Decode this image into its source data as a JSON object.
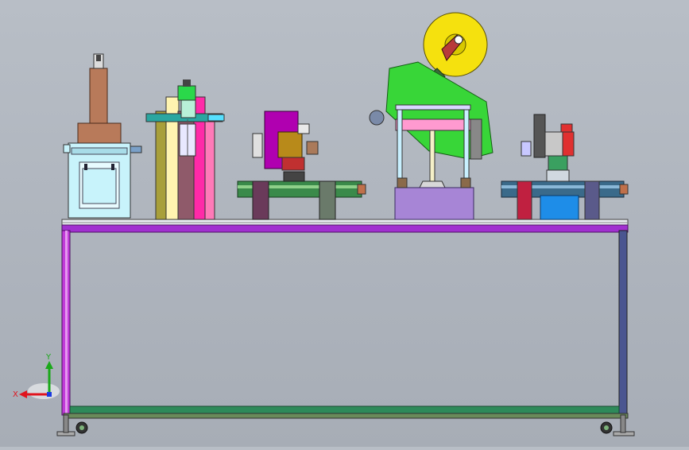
{
  "viewport": {
    "background": [
      "#b8bec6",
      "#a7adb6"
    ]
  },
  "triad": {
    "x_label": "X",
    "y_label": "Y",
    "x_color": "#e0141e",
    "y_color": "#1aa81a",
    "z_color": "#1a3ae0"
  },
  "model": {
    "frame_color": "#8b1fb8",
    "frame_rail_color": "#d06fe6",
    "station_colors": {
      "press_head": "#b87a5a",
      "press_frame": "#b8f2ff",
      "lift_column": "#ff2aa8",
      "stamp_block": "#b000b0",
      "conveyor": "#3a8a4a",
      "labeler_arm": "#38d638",
      "tape_reel": "#f5e10e",
      "base_block": "#a785d6",
      "blue_box": "#1e8de8"
    }
  }
}
